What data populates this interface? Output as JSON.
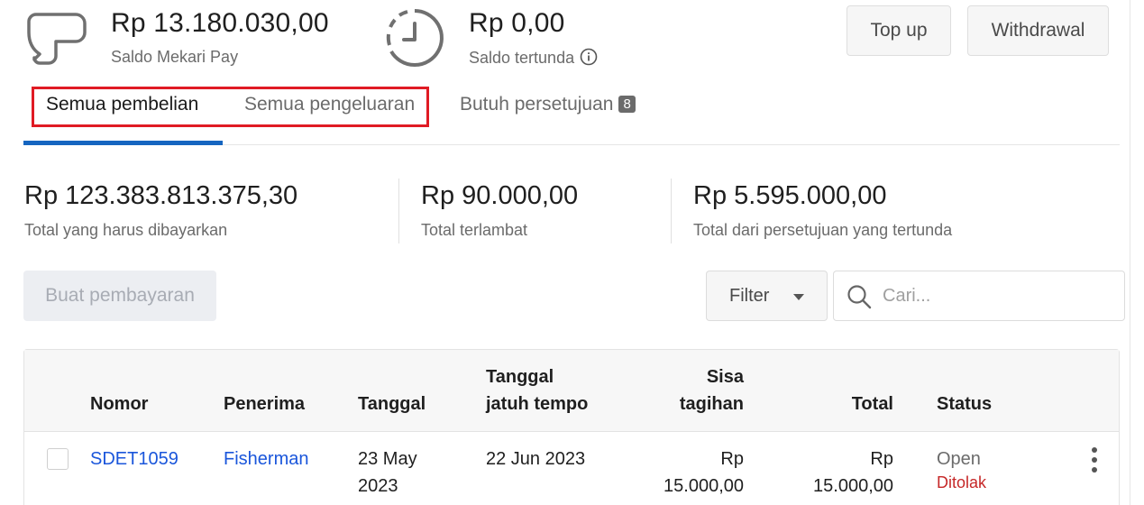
{
  "wallet": {
    "balance": "Rp 13.180.030,00",
    "balance_label": "Saldo Mekari Pay",
    "pending": "Rp 0,00",
    "pending_label": "Saldo tertunda"
  },
  "actions": {
    "topup_label": "Top up",
    "withdrawal_label": "Withdrawal"
  },
  "tabs": [
    {
      "label": "Semua pembelian",
      "active": true
    },
    {
      "label": "Semua pengeluaran",
      "active": false
    },
    {
      "label": "Butuh persetujuan",
      "active": false,
      "badge": "8"
    }
  ],
  "summary": [
    {
      "value": "Rp 123.383.813.375,30",
      "label": "Total yang harus dibayarkan"
    },
    {
      "value": "Rp 90.000,00",
      "label": "Total terlambat"
    },
    {
      "value": "Rp 5.595.000,00",
      "label": "Total dari persetujuan yang tertunda"
    }
  ],
  "toolbar": {
    "create_payment_label": "Buat pembayaran",
    "filter_label": "Filter",
    "search_placeholder": "Cari..."
  },
  "table": {
    "headers": {
      "nomor": "Nomor",
      "penerima": "Penerima",
      "tanggal": "Tanggal",
      "jatuh_tempo_1": "Tanggal",
      "jatuh_tempo_2": "jatuh tempo",
      "sisa_1": "Sisa",
      "sisa_2": "tagihan",
      "total": "Total",
      "status": "Status"
    },
    "rows": [
      {
        "nomor": "SDET1059",
        "penerima": "Fisherman",
        "tanggal_1": "23 May",
        "tanggal_2": "2023",
        "jatuh_tempo": "22 Jun 2023",
        "sisa_1": "Rp",
        "sisa_2": "15.000,00",
        "total_1": "Rp",
        "total_2": "15.000,00",
        "status": "Open",
        "approval": "Ditolak"
      }
    ]
  },
  "icons": {
    "wallet": "wallet-icon",
    "pending": "clock-icon",
    "info": "info-icon",
    "search": "search-icon",
    "caret": "chevron-down-icon",
    "more": "kebab-menu-icon"
  },
  "colors": {
    "accent": "#1565c0",
    "link": "#1a56db",
    "highlight": "#e01b24",
    "rejected": "#c62828"
  }
}
